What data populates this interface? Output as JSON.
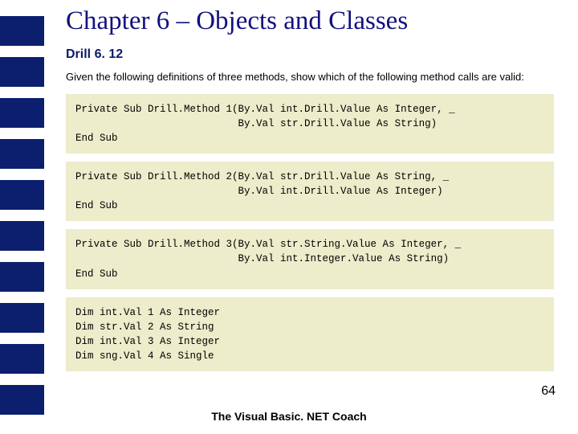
{
  "title": "Chapter 6 – Objects and Classes",
  "drill_heading": "Drill 6. 12",
  "prompt": "Given the following definitions of three methods, show which of the following method calls are valid:",
  "codeblocks": [
    "Private Sub Drill.Method 1(By.Val int.Drill.Value As Integer, _\n                           By.Val str.Drill.Value As String)\nEnd Sub",
    "Private Sub Drill.Method 2(By.Val str.Drill.Value As String, _\n                           By.Val int.Drill.Value As Integer)\nEnd Sub",
    "Private Sub Drill.Method 3(By.Val str.String.Value As Integer, _\n                           By.Val int.Integer.Value As String)\nEnd Sub",
    "Dim int.Val 1 As Integer\nDim str.Val 2 As String\nDim int.Val 3 As Integer\nDim sng.Val 4 As Single"
  ],
  "page_number": "64",
  "footer": "The Visual Basic. NET Coach"
}
